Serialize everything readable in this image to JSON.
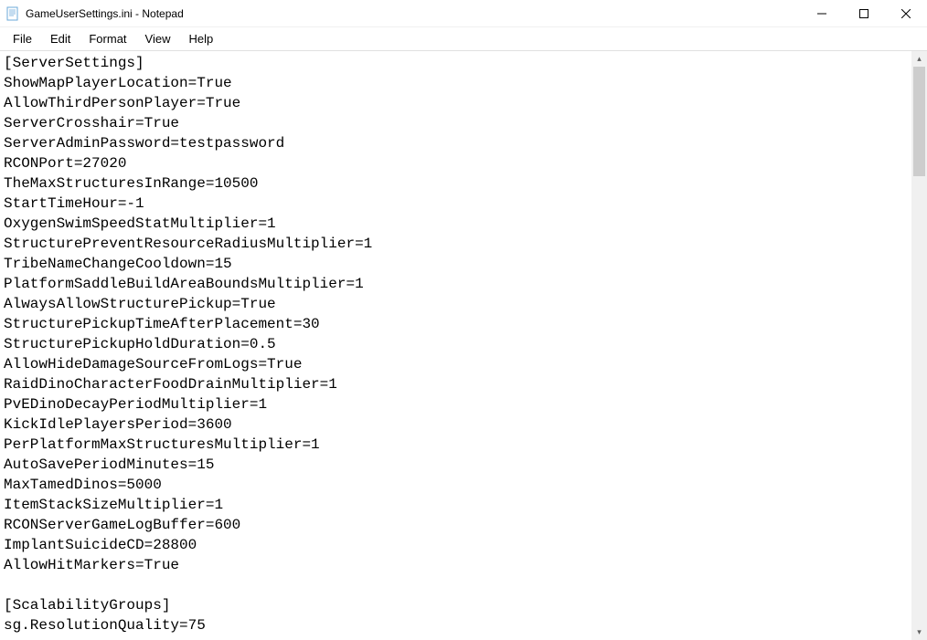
{
  "window": {
    "title": "GameUserSettings.ini - Notepad"
  },
  "menu": {
    "file": "File",
    "edit": "Edit",
    "format": "Format",
    "view": "View",
    "help": "Help"
  },
  "content": {
    "lines": [
      "[ServerSettings]",
      "ShowMapPlayerLocation=True",
      "AllowThirdPersonPlayer=True",
      "ServerCrosshair=True",
      "ServerAdminPassword=testpassword",
      "RCONPort=27020",
      "TheMaxStructuresInRange=10500",
      "StartTimeHour=-1",
      "OxygenSwimSpeedStatMultiplier=1",
      "StructurePreventResourceRadiusMultiplier=1",
      "TribeNameChangeCooldown=15",
      "PlatformSaddleBuildAreaBoundsMultiplier=1",
      "AlwaysAllowStructurePickup=True",
      "StructurePickupTimeAfterPlacement=30",
      "StructurePickupHoldDuration=0.5",
      "AllowHideDamageSourceFromLogs=True",
      "RaidDinoCharacterFoodDrainMultiplier=1",
      "PvEDinoDecayPeriodMultiplier=1",
      "KickIdlePlayersPeriod=3600",
      "PerPlatformMaxStructuresMultiplier=1",
      "AutoSavePeriodMinutes=15",
      "MaxTamedDinos=5000",
      "ItemStackSizeMultiplier=1",
      "RCONServerGameLogBuffer=600",
      "ImplantSuicideCD=28800",
      "AllowHitMarkers=True",
      "",
      "[ScalabilityGroups]",
      "sg.ResolutionQuality=75"
    ]
  }
}
